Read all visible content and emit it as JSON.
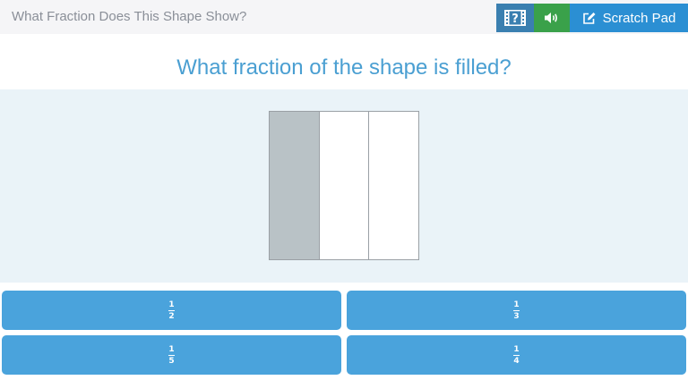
{
  "header": {
    "title": "What Fraction Does This Shape Show?",
    "scratch_pad_label": "Scratch Pad",
    "video_icon": "film-question-icon",
    "audio_icon": "speaker-icon",
    "scratch_icon": "pencil-square-icon"
  },
  "question": "What fraction of the shape is filled?",
  "shape": {
    "parts": 3,
    "filled": 1
  },
  "answers": [
    {
      "numerator": "1",
      "denominator": "2"
    },
    {
      "numerator": "1",
      "denominator": "3"
    },
    {
      "numerator": "1",
      "denominator": "5"
    },
    {
      "numerator": "1",
      "denominator": "4"
    }
  ],
  "colors": {
    "header_bg": "#f5f5f7",
    "video_button": "#3a7fb0",
    "audio_button": "#3aa14a",
    "scratch_button": "#2b8fd3",
    "question_text": "#4a9fd2",
    "shape_area_bg": "#eaf3f8",
    "filled_part": "#b9c2c6",
    "answer_button": "#4aa3dc"
  }
}
